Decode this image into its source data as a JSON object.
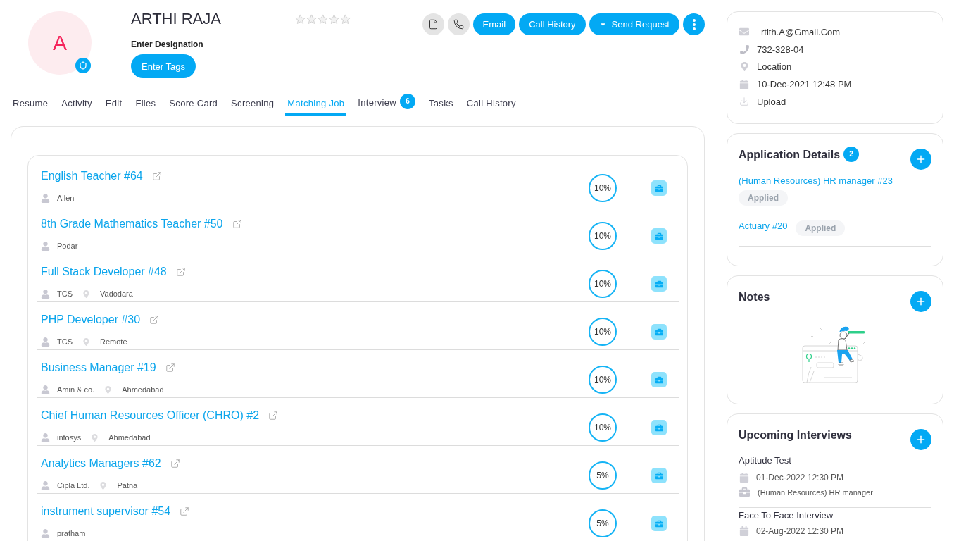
{
  "profile": {
    "initial": "A",
    "name": "ARTHI RAJA",
    "stars": 0,
    "designation": "Enter Designation",
    "tags_button": "Enter Tags"
  },
  "actions": [
    {
      "label": "Email",
      "kind": "plain"
    },
    {
      "label": "Call History",
      "kind": "plain"
    },
    {
      "label": "Send Request",
      "kind": "dropdown"
    }
  ],
  "tabs": [
    {
      "label": "Resume",
      "selected": false
    },
    {
      "label": "Activity",
      "selected": false
    },
    {
      "label": "Edit",
      "selected": false
    },
    {
      "label": "Files",
      "selected": false
    },
    {
      "label": "Score Card",
      "selected": false
    },
    {
      "label": "Screening",
      "selected": false
    },
    {
      "label": "Matching Job",
      "selected": true
    },
    {
      "label": "Interview",
      "selected": false,
      "badge": "6"
    },
    {
      "label": "Tasks",
      "selected": false
    },
    {
      "label": "Call History",
      "selected": false
    }
  ],
  "matching_jobs": [
    {
      "title": "English Teacher #64",
      "company": "Allen",
      "match": "10%"
    },
    {
      "title": "8th Grade Mathematics Teacher #50",
      "company": "Podar",
      "match": "10%"
    },
    {
      "title": "Full Stack Developer #48",
      "company": "TCS",
      "location": "Vadodara",
      "match": "10%"
    },
    {
      "title": "PHP Developer #30",
      "company": "TCS",
      "location": "Remote",
      "match": "10%"
    },
    {
      "title": "Business Manager #19",
      "company": "Amin & co.",
      "location": "Ahmedabad",
      "match": "10%"
    },
    {
      "title": "Chief Human Resources Officer (CHRO) #2",
      "company": "infosys",
      "location": "Ahmedabad",
      "match": "10%"
    },
    {
      "title": "Analytics Managers #62",
      "company": "Cipla Ltd.",
      "location": "Patna",
      "match": "5%"
    },
    {
      "title": "instrument supervisor #54",
      "company": "pratham",
      "match": "5%"
    }
  ],
  "contact": [
    {
      "kind": "email",
      "text": "rtith.A@Gmail.Com"
    },
    {
      "kind": "phone",
      "text": "732-328-04"
    },
    {
      "kind": "location",
      "text": "Location"
    },
    {
      "kind": "date",
      "text": "10-Dec-2021 12:48 PM"
    },
    {
      "kind": "upload",
      "text": "Upload"
    }
  ],
  "application_details": {
    "title": "Application Details",
    "count": "2",
    "items": [
      {
        "job": "(Human Resources) HR manager #23",
        "status": "Applied"
      },
      {
        "job": "Actuary #20",
        "status": "Applied"
      }
    ]
  },
  "notes": {
    "title": "Notes"
  },
  "upcoming_interviews": {
    "title": "Upcoming Interviews",
    "items": [
      {
        "name": "Aptitude Test",
        "date": "01-Dec-2022 12:30 PM",
        "job": "(Human Resources) HR manager"
      },
      {
        "name": "Face To Face Interview",
        "date": "02-Aug-2022 12:30 PM"
      }
    ]
  }
}
